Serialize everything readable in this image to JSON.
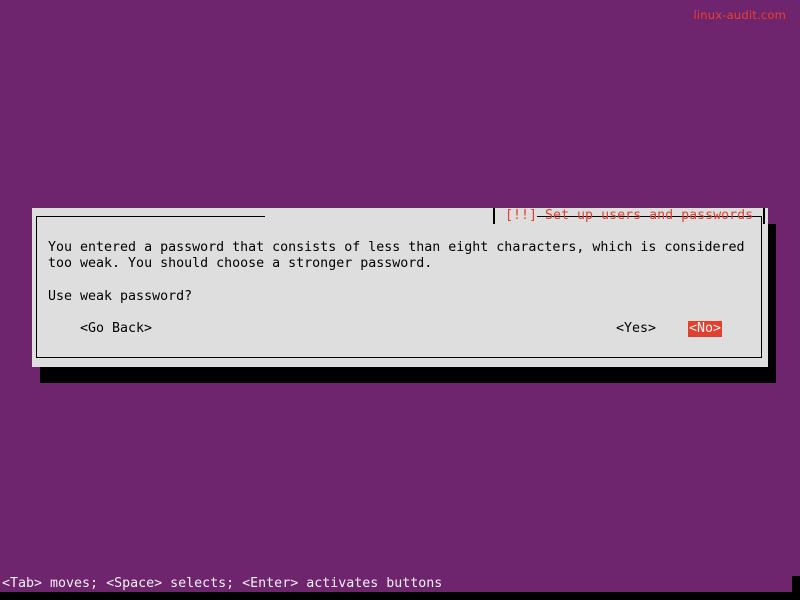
{
  "watermark": "linux-audit.com",
  "dialog": {
    "title": "[!!] Set up users and passwords",
    "message_lines": [
      "You entered a password that consists of less than eight characters, which is considered",
      "too weak. You should choose a stronger password."
    ],
    "question": "Use weak password?",
    "buttons": {
      "go_back": "<Go Back>",
      "yes": "<Yes>",
      "no": "<No>"
    },
    "selected_button": "no"
  },
  "status_bar": {
    "text": "<Tab> moves; <Space> selects; <Enter> activates buttons"
  },
  "colors": {
    "background": "#6f246e",
    "dialog": "#dedede",
    "accent": "#e0402d"
  }
}
